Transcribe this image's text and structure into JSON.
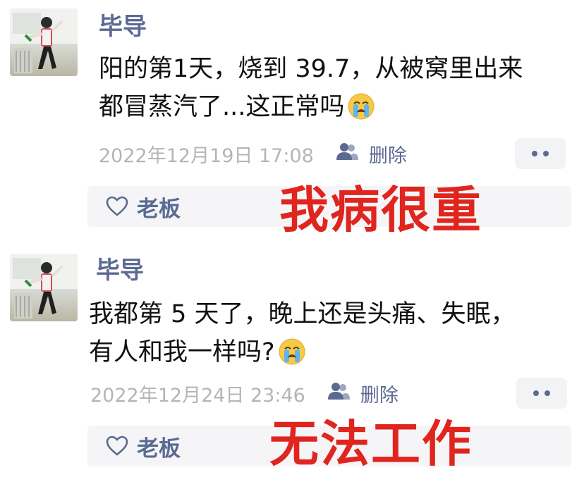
{
  "posts": [
    {
      "author": "毕导",
      "line1": "阳的第1天，烧到 39.7，从被窝里出来",
      "line2": "都冒蒸汽了...这正常吗",
      "timestamp": "2022年12月19日 17:08",
      "delete_label": "删除",
      "liker": "老板",
      "caption": "我病很重"
    },
    {
      "author": "毕导",
      "line1": "我都第 5 天了，晚上还是头痛、失眠，",
      "line2": "有人和我一样吗?",
      "timestamp": "2022年12月24日 23:46",
      "delete_label": "删除",
      "liker": "老板",
      "caption": "无法工作"
    }
  ],
  "icons": {
    "emoji": "crying-face-icon",
    "visibility": "person-icon",
    "more": "more-dots-icon",
    "like": "heart-icon"
  },
  "colors": {
    "name": "#5b6a93",
    "timestamp": "#b5b5b5",
    "caption": "#e0251f",
    "likebar_bg": "#f5f5f7"
  }
}
